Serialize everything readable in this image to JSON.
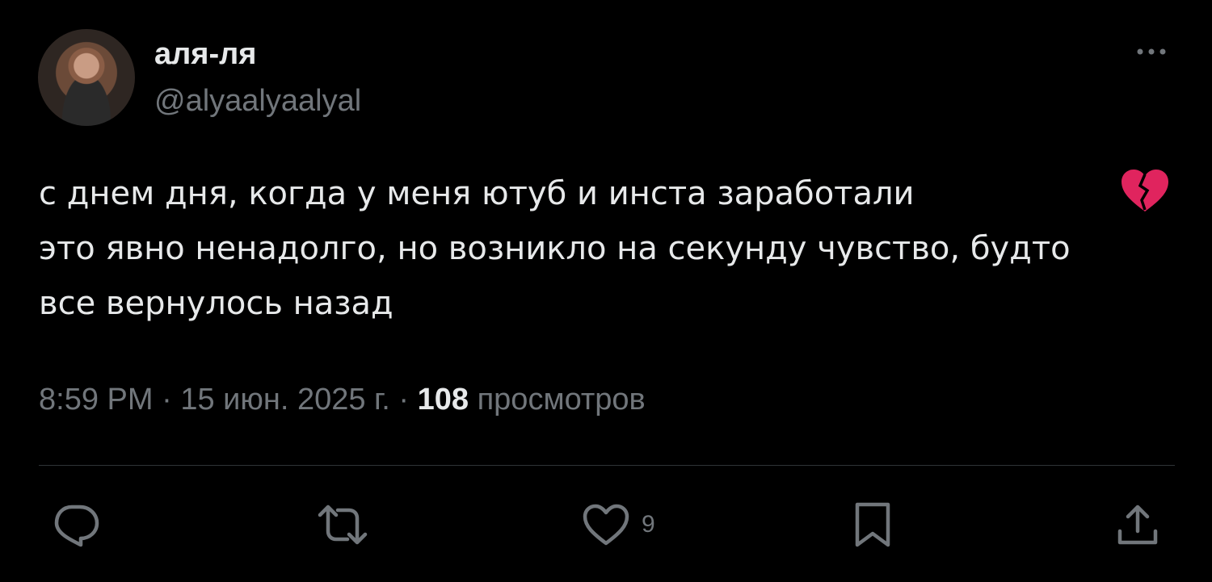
{
  "author": {
    "display_name": "аля-ля",
    "handle": "@alyaalyaalyal",
    "avatar_icon": "profile-photo"
  },
  "tweet": {
    "lines": [
      "с днем дня, когда у меня ютуб и инста заработали",
      "это явно ненадолго, но возникло на секунду чувство, будто",
      "все вернулось назад"
    ],
    "emoji_icon": "broken-heart-icon"
  },
  "meta": {
    "time": "8:59 PM",
    "separator": "·",
    "date": "15 июн. 2025 г.",
    "views_count": "108",
    "views_label": "просмотров"
  },
  "actions": {
    "reply_icon": "reply-icon",
    "retweet_icon": "retweet-icon",
    "like_icon": "heart-icon",
    "like_count": "9",
    "bookmark_icon": "bookmark-icon",
    "share_icon": "share-icon"
  },
  "colors": {
    "background": "#000000",
    "primary_text": "#e7e9ea",
    "secondary_text": "#71767b",
    "divider": "#2f3336",
    "emoji_red": "#e0245e"
  }
}
